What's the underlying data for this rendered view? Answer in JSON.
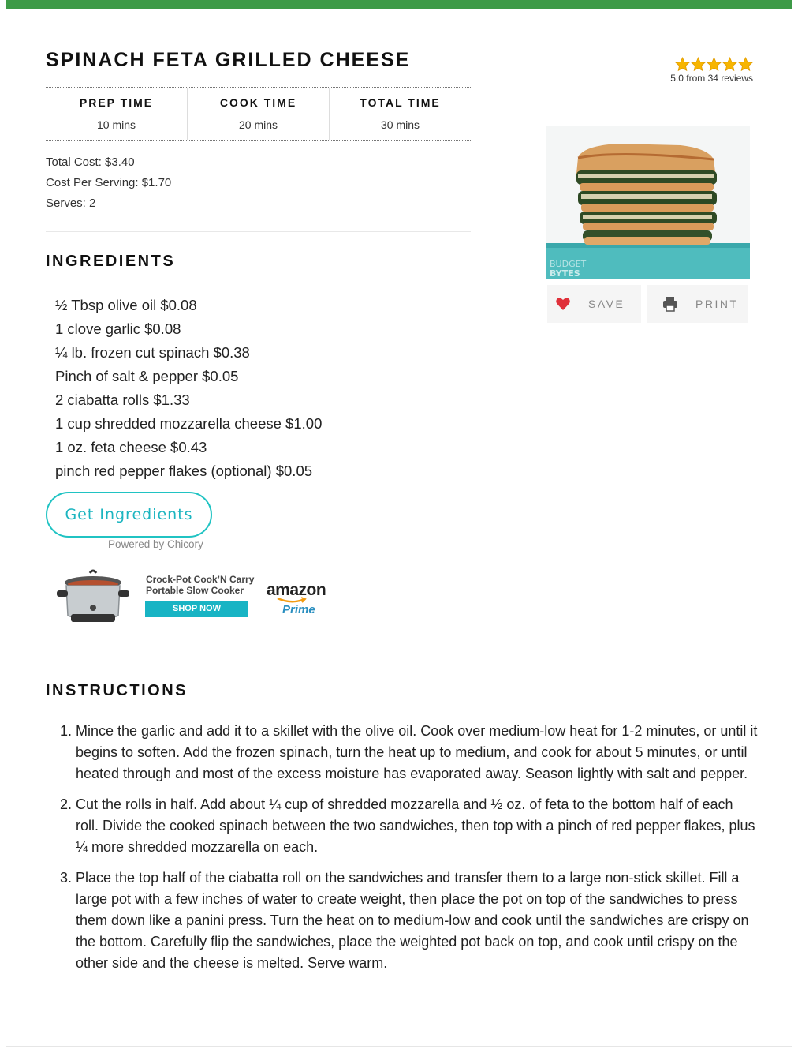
{
  "recipe": {
    "title": "SPINACH FETA GRILLED CHEESE",
    "rating_text": "5.0 from 34 reviews",
    "rating_value": 5,
    "times": [
      {
        "label": "PREP TIME",
        "value": "10 mins"
      },
      {
        "label": "COOK TIME",
        "value": "20 mins"
      },
      {
        "label": "TOTAL TIME",
        "value": "30 mins"
      }
    ],
    "total_cost": "Total Cost: $3.40",
    "cost_per_serving": "Cost Per Serving: $1.70",
    "serves": "Serves: 2",
    "photo_watermark": [
      "BUDGET",
      "BYTES"
    ]
  },
  "actions": {
    "save_label": "SAVE",
    "print_label": "PRINT"
  },
  "ingredients": {
    "heading": "INGREDIENTS",
    "items": [
      "½ Tbsp olive oil $0.08",
      "1 clove garlic $0.08",
      "¼ lb. frozen cut spinach $0.38",
      "Pinch of salt & pepper $0.05",
      "2 ciabatta rolls $1.33",
      "1 cup shredded mozzarella cheese $1.00",
      "1 oz. feta cheese $0.43",
      "pinch red pepper flakes (optional) $0.05"
    ],
    "get_button": "Get Ingredients",
    "powered_by": "Powered by Chicory"
  },
  "ad": {
    "title_line1": "Crock-Pot Cook’N Carry",
    "title_line2": "Portable Slow Cooker",
    "shop_label": "SHOP NOW",
    "brand": "amazon",
    "brand_sub": "Prime"
  },
  "instructions": {
    "heading": "INSTRUCTIONS",
    "steps": [
      "Mince the garlic and add it to a skillet with the olive oil. Cook over medium-low heat for 1-2 minutes, or until it begins to soften. Add the frozen spinach, turn the heat up to medium, and cook for about 5 minutes, or until heated through and most of the excess moisture has evaporated away. Season lightly with salt and pepper.",
      "Cut the rolls in half. Add about ¼ cup of shredded mozzarella and ½ oz. of feta to the bottom half of each roll. Divide the cooked spinach between the two sandwiches, then top with a pinch of red pepper flakes, plus ¼ more shredded mozzarella on each.",
      "Place the top half of the ciabatta roll on the sandwiches and transfer them to a large non-stick skillet. Fill a large pot with a few inches of water to create weight, then place the pot on top of the sandwiches to press them down like a panini press. Turn the heat on to medium-low and cook until the sandwiches are crispy on the bottom. Carefully flip the sandwiches, place the weighted pot back on top, and cook until crispy on the other side and the cheese is melted. Serve warm."
    ]
  },
  "colors": {
    "brand_green": "#3d9a47",
    "accent_teal": "#1cb5c0",
    "star_gold": "#f7b500",
    "heart_red": "#e0303a"
  }
}
